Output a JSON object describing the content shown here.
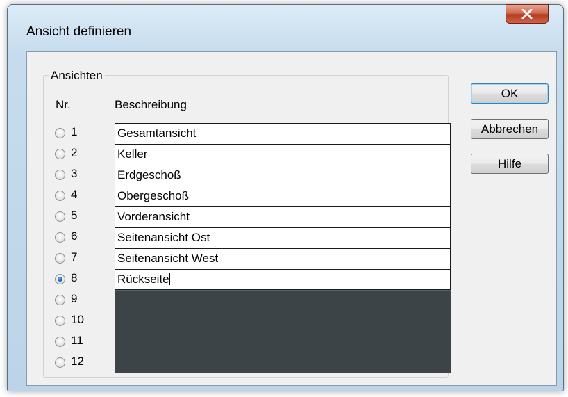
{
  "window": {
    "title": "Ansicht definieren",
    "close_label": "X"
  },
  "group": {
    "legend": "Ansichten",
    "col_nr": "Nr.",
    "col_desc": "Beschreibung",
    "selected": 8,
    "rows": [
      {
        "nr": "1",
        "desc": "Gesamtansicht"
      },
      {
        "nr": "2",
        "desc": "Keller"
      },
      {
        "nr": "3",
        "desc": "Erdgeschoß"
      },
      {
        "nr": "4",
        "desc": "Obergeschoß"
      },
      {
        "nr": "5",
        "desc": "Vorderansicht"
      },
      {
        "nr": "6",
        "desc": "Seitenansicht Ost"
      },
      {
        "nr": "7",
        "desc": "Seitenansicht West"
      },
      {
        "nr": "8",
        "desc": "Rückseite"
      },
      {
        "nr": "9",
        "desc": ""
      },
      {
        "nr": "10",
        "desc": ""
      },
      {
        "nr": "11",
        "desc": ""
      },
      {
        "nr": "12",
        "desc": ""
      }
    ]
  },
  "buttons": {
    "ok": "OK",
    "cancel": "Abbrechen",
    "help": "Hilfe"
  },
  "colors": {
    "empty_field": "#3c4448",
    "close_button": "#c4472c",
    "radio_selected": "#1e5ec0"
  }
}
